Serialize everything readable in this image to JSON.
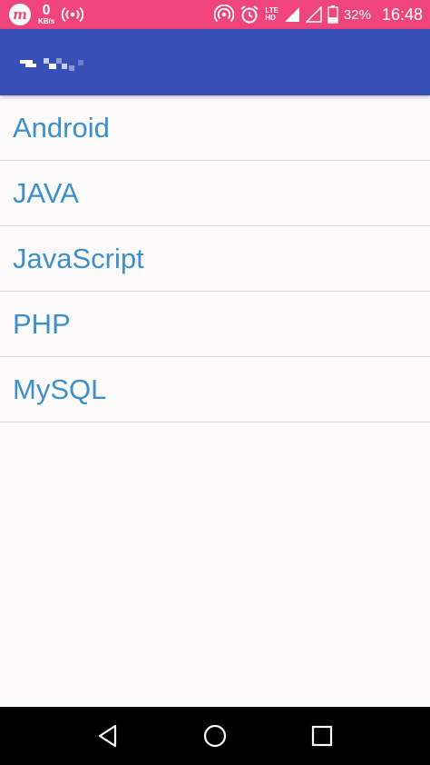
{
  "status_bar": {
    "app_icon_letter": "m",
    "net_speed_value": "0",
    "net_speed_unit": "KB/s",
    "network_type": "LTE",
    "network_sub": "HD",
    "battery_percent": "32%",
    "time": "16:48",
    "icons": [
      "hotspot-icon",
      "alarm-icon",
      "signal-icon",
      "battery-icon",
      "broadcast-icon"
    ],
    "background_color": "#f0457a"
  },
  "app_bar": {
    "color": "#3650b6"
  },
  "list": {
    "items": [
      {
        "label": "Android"
      },
      {
        "label": "JAVA"
      },
      {
        "label": "JavaScript"
      },
      {
        "label": "PHP"
      },
      {
        "label": "MySQL"
      }
    ],
    "text_color": "#3a8fcc"
  },
  "nav_bar": {
    "buttons": [
      "back-icon",
      "home-icon",
      "recents-icon"
    ]
  }
}
